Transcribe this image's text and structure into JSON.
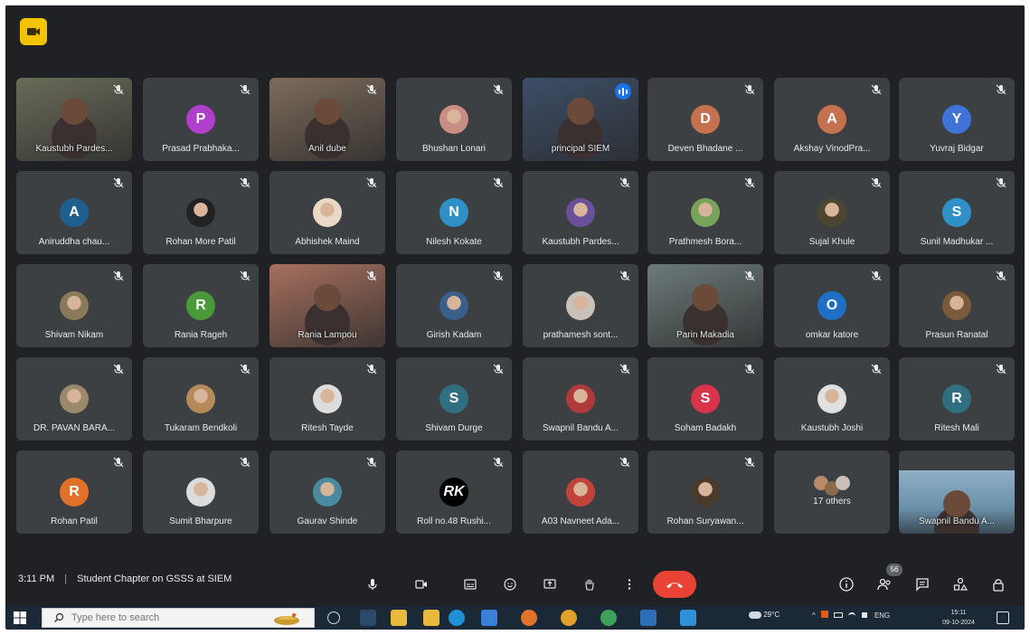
{
  "brand_icon": "meet-camera-icon",
  "participants": [
    {
      "name": "Kaustubh Pardes...",
      "kind": "video",
      "color": "#6b6b5a"
    },
    {
      "name": "Prasad Prabhaka...",
      "kind": "letter",
      "letter": "P",
      "color": "#b03fcc"
    },
    {
      "name": "Anil dube",
      "kind": "video",
      "color": "#7d6b5b"
    },
    {
      "name": "Bhushan Lonari",
      "kind": "photo",
      "color": "#c98e83"
    },
    {
      "name": "principal SIEM",
      "kind": "video",
      "color": "#3d4e68",
      "speaking": true
    },
    {
      "name": "Deven Bhadane ...",
      "kind": "letter",
      "letter": "D",
      "color": "#c5714f"
    },
    {
      "name": "Akshay VinodPra...",
      "kind": "letter",
      "letter": "A",
      "color": "#c5714f"
    },
    {
      "name": "Yuvraj Bidgar",
      "kind": "letter",
      "letter": "Y",
      "color": "#3f73d8"
    },
    {
      "name": "Aniruddha chau...",
      "kind": "letter",
      "letter": "A",
      "color": "#1f5f8f"
    },
    {
      "name": "Rohan More Patil",
      "kind": "photo",
      "color": "#222222"
    },
    {
      "name": "Abhishek Maind",
      "kind": "photo",
      "color": "#e8d8c5"
    },
    {
      "name": "Nilesh Kokate",
      "kind": "letter",
      "letter": "N",
      "color": "#2f8fc7"
    },
    {
      "name": "Kaustubh Pardes...",
      "kind": "photo",
      "color": "#6a4f9a"
    },
    {
      "name": "Prathmesh Bora...",
      "kind": "photo",
      "color": "#7aa35a"
    },
    {
      "name": "Sujal Khule",
      "kind": "photo",
      "color": "#4c4630"
    },
    {
      "name": "Sunil Madhukar ...",
      "kind": "letter",
      "letter": "S",
      "color": "#2f8fc7"
    },
    {
      "name": "Shivam Nikam",
      "kind": "photo",
      "color": "#8a7a5a"
    },
    {
      "name": "Rania Rageh",
      "kind": "letter",
      "letter": "R",
      "color": "#4a9a3a"
    },
    {
      "name": "Rania Lampou",
      "kind": "video",
      "color": "#a7705e"
    },
    {
      "name": "Girish Kadam",
      "kind": "photo",
      "color": "#3a5f8a"
    },
    {
      "name": "prathamesh sont...",
      "kind": "photo",
      "color": "#c9c1b9"
    },
    {
      "name": "Parin Makadia",
      "kind": "video",
      "color": "#6d7a7a"
    },
    {
      "name": "omkar katore",
      "kind": "letter",
      "letter": "O",
      "color": "#1f6fc7"
    },
    {
      "name": "Prasun Ranatal",
      "kind": "photo",
      "color": "#7a5a3a"
    },
    {
      "name": "DR. PAVAN BARA...",
      "kind": "photo",
      "color": "#9a8a6a"
    },
    {
      "name": "Tukaram Bendkoli",
      "kind": "photo",
      "color": "#b58a5a"
    },
    {
      "name": "Ritesh Tayde",
      "kind": "photo",
      "color": "#dddddd"
    },
    {
      "name": "Shivam Durge",
      "kind": "letter",
      "letter": "S",
      "color": "#2f6f7f"
    },
    {
      "name": "Swapnil Bandu A...",
      "kind": "photo",
      "color": "#b03a3a"
    },
    {
      "name": "Soham Badakh",
      "kind": "letter",
      "letter": "S",
      "color": "#d8344a"
    },
    {
      "name": "Kaustubh Joshi",
      "kind": "photo",
      "color": "#e0e0e0"
    },
    {
      "name": "Ritesh Mali",
      "kind": "letter",
      "letter": "R",
      "color": "#2f6f7f"
    },
    {
      "name": "Rohan Patil",
      "kind": "letter",
      "letter": "R",
      "color": "#e0702a"
    },
    {
      "name": "Sumit Bharpure",
      "kind": "photo",
      "color": "#dcdcdc"
    },
    {
      "name": "Gaurav Shinde",
      "kind": "photo",
      "color": "#4a8aa0"
    },
    {
      "name": "Roll no.48 Rushi...",
      "kind": "logo",
      "logo": "RK",
      "color": "#000000"
    },
    {
      "name": "A03 Navneet Ada...",
      "kind": "photo",
      "color": "#c0443a"
    },
    {
      "name": "Rohan Suryawan...",
      "kind": "photo",
      "color": "#4a3a2a"
    },
    {
      "name": "17 others",
      "kind": "others",
      "color": "#6a6a6a"
    },
    {
      "name": "Swapnil Bandu A...",
      "kind": "selfview",
      "color": "#6a8fa8"
    }
  ],
  "toolbar": {
    "time": "3:11 PM",
    "separator": "|",
    "meeting_title": "Student Chapter on GSSS at SIEM",
    "people_count": "56",
    "controls": [
      "mic-icon",
      "camera-icon",
      "captions-icon",
      "emoji-icon",
      "present-icon",
      "raise-hand-icon",
      "more-options-icon"
    ],
    "end_call_icon": "end-call-icon",
    "right_controls": [
      "info-icon",
      "people-icon",
      "chat-icon",
      "activities-icon",
      "host-controls-icon"
    ],
    "colors": {
      "end_call": "#ea4335",
      "speaking": "#1a73e8"
    }
  },
  "taskbar": {
    "search_placeholder": "Type here to search",
    "weather": "29°C",
    "language": "ENG",
    "clock_time": "15:11",
    "clock_date": "09-10-2024",
    "apps": [
      "task-view-icon",
      "file-explorer-icon",
      "edge-icon",
      "store-icon",
      "firefox-icon",
      "chrome-icon",
      "chrome-profile-icon",
      "mail-icon",
      "photos-icon"
    ]
  }
}
